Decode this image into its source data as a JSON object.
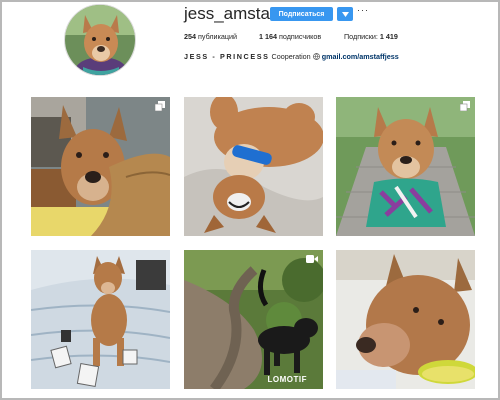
{
  "profile": {
    "username": "jess_amstaff",
    "follow_label": "Подписаться",
    "more_label": "···"
  },
  "stats": {
    "posts_count": "254",
    "posts_label": "публикаций",
    "followers_count": "1 164",
    "followers_label": "подписчиков",
    "following_label": "Подписки:",
    "following_count": "1 419"
  },
  "bio": {
    "name": "JESS - PRINCESS",
    "text": "Cooperation",
    "link": "gmail.com/amstaffjess"
  },
  "posts": [
    {
      "type": "multiple",
      "icon": "multiple-photos-icon"
    },
    {
      "type": "single"
    },
    {
      "type": "multiple",
      "icon": "multiple-photos-icon"
    },
    {
      "type": "single"
    },
    {
      "type": "video",
      "icon": "video-icon",
      "watermark": "LOMOTIF"
    },
    {
      "type": "single"
    }
  ],
  "colors": {
    "accent": "#3897f0",
    "link": "#003569",
    "border": "#b8b8b8"
  }
}
